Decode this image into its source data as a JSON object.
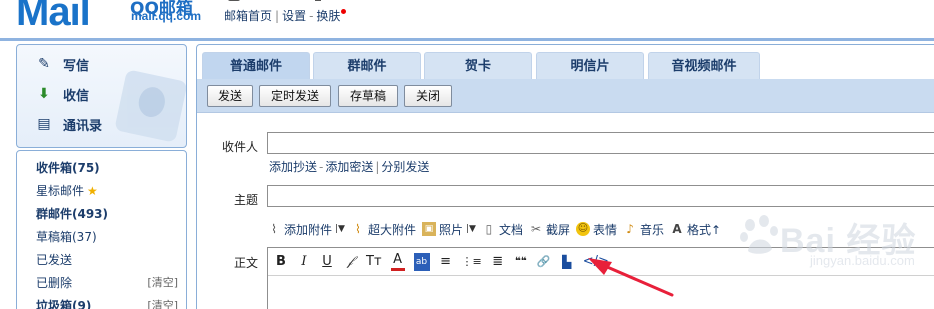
{
  "header": {
    "logo_text": "Mail",
    "logo_qq": "QQ邮箱",
    "logo_domain": "mail.qq.com",
    "links": [
      "邮箱首页",
      "设置",
      "换肤"
    ]
  },
  "sidebar": {
    "actions": [
      {
        "label": "写信",
        "icon": "pencil-paper-icon"
      },
      {
        "label": "收信",
        "icon": "inbox-download-icon"
      },
      {
        "label": "通讯录",
        "icon": "contact-card-icon"
      }
    ],
    "folders": [
      {
        "label": "收件箱(75)",
        "bold": true
      },
      {
        "label": "星标邮件",
        "bold": false,
        "star": "★"
      },
      {
        "label": "群邮件(493)",
        "bold": true
      },
      {
        "label": "草稿箱(37)",
        "bold": false
      },
      {
        "label": "已发送",
        "bold": false
      },
      {
        "label": "已删除",
        "bold": false,
        "clear": "[清空]"
      },
      {
        "label": "垃圾箱(9)",
        "bold": true,
        "clear": "[清空]"
      }
    ]
  },
  "compose": {
    "tabs": [
      "普通邮件",
      "群邮件",
      "贺卡",
      "明信片",
      "音视频邮件"
    ],
    "toolbar": [
      "发送",
      "定时发送",
      "存草稿",
      "关闭"
    ],
    "recipient_label": "收件人",
    "recipient_links": [
      "添加抄送",
      "添加密送",
      "分别发送"
    ],
    "subject_label": "主题",
    "attach": {
      "add_attachment": "添加附件",
      "big_attachment": "超大附件",
      "photo": "照片",
      "document": "文档",
      "screenshot": "截屏",
      "emoticon": "表情",
      "music": "音乐",
      "format": "格式↑"
    },
    "body_label": "正文",
    "format_tools": [
      "B",
      "I",
      "U",
      "𝒻",
      "Tт",
      "A",
      "ab",
      "≡",
      "⋮≡",
      "≣",
      "❝❝",
      "🔗",
      "▙",
      "</>"
    ]
  },
  "watermark": {
    "main": "Bai 经验",
    "sub": "jingyan.baidu.com"
  },
  "colors": {
    "accent": "#1a73c9",
    "tab_bg": "#d5e3f3",
    "toolbar_bg": "#c9dbf0",
    "annotation_arrow": "#e8203a"
  }
}
